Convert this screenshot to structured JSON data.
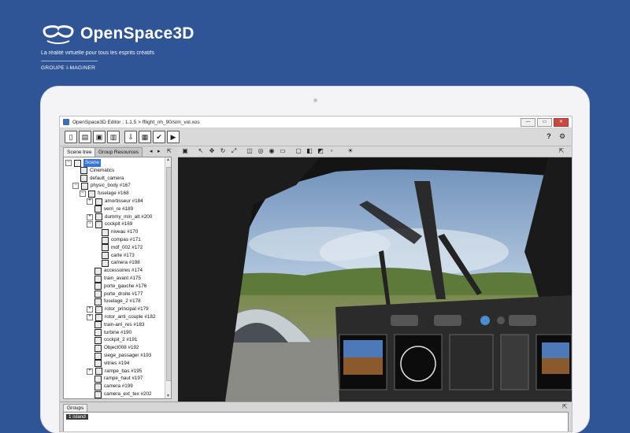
{
  "brand": {
    "title": "OpenSpace3D",
    "tagline": "La réalité virtuelle pour tous les esprits créatifs",
    "company": "GROUPE I-MAGINER"
  },
  "window": {
    "title": "OpenSpace3D Editor : 1.1.5 > fflight_nh_90/sim_vol.xos",
    "buttons": [
      "—",
      "▭",
      "✕"
    ]
  },
  "main_toolbar": {
    "left_icons": [
      "new-project-icon",
      "open-project-icon",
      "save-icon",
      "save-as-icon",
      "import-icon",
      "package-icon",
      "plugit-icon",
      "run-icon"
    ],
    "right_icons": [
      "help-icon",
      "settings-icon"
    ],
    "help_glyph": "?",
    "settings_glyph": "⚙"
  },
  "left_panel": {
    "tabs": [
      "Scene tree",
      "Group Resources"
    ],
    "tree": [
      {
        "label": "Scene",
        "depth": 0,
        "expander": "−",
        "selected": true
      },
      {
        "label": "Cinematics",
        "depth": 1,
        "expander": ""
      },
      {
        "label": "default_camera",
        "depth": 1,
        "expander": ""
      },
      {
        "label": "physic_body #167",
        "depth": 1,
        "expander": "−"
      },
      {
        "label": "fuselage #168",
        "depth": 2,
        "expander": "−"
      },
      {
        "label": "amortisseur #184",
        "depth": 3,
        "expander": "+"
      },
      {
        "label": "verri_re #189",
        "depth": 3,
        "expander": ""
      },
      {
        "label": "dummy_min_alt #200",
        "depth": 3,
        "expander": "+"
      },
      {
        "label": "cockpit #169",
        "depth": 3,
        "expander": "−"
      },
      {
        "label": "niveau #170",
        "depth": 4,
        "expander": ""
      },
      {
        "label": "compas #171",
        "depth": 4,
        "expander": ""
      },
      {
        "label": "mdf_002 #172",
        "depth": 4,
        "expander": ""
      },
      {
        "label": "carte #173",
        "depth": 4,
        "expander": ""
      },
      {
        "label": "camera #198",
        "depth": 4,
        "expander": ""
      },
      {
        "label": "accessoires #174",
        "depth": 3,
        "expander": ""
      },
      {
        "label": "train_avant #175",
        "depth": 3,
        "expander": ""
      },
      {
        "label": "porte_gauche #176",
        "depth": 3,
        "expander": ""
      },
      {
        "label": "porte_droite #177",
        "depth": 3,
        "expander": ""
      },
      {
        "label": "fuselage_2 #178",
        "depth": 3,
        "expander": ""
      },
      {
        "label": "rotor_principal #179",
        "depth": 3,
        "expander": "+"
      },
      {
        "label": "rotor_anti_couple #182",
        "depth": 3,
        "expander": "+"
      },
      {
        "label": "train-arri_res #183",
        "depth": 3,
        "expander": ""
      },
      {
        "label": "turbine #190",
        "depth": 3,
        "expander": ""
      },
      {
        "label": "cockpit_2 #191",
        "depth": 3,
        "expander": ""
      },
      {
        "label": "Object008 #192",
        "depth": 3,
        "expander": ""
      },
      {
        "label": "siege_passager #193",
        "depth": 3,
        "expander": ""
      },
      {
        "label": "vitries #194",
        "depth": 3,
        "expander": ""
      },
      {
        "label": "rampe_bas #195",
        "depth": 3,
        "expander": "+"
      },
      {
        "label": "rampe_haut #197",
        "depth": 3,
        "expander": ""
      },
      {
        "label": "camera #199",
        "depth": 3,
        "expander": ""
      },
      {
        "label": "camera_ext_tex #202",
        "depth": 3,
        "expander": ""
      }
    ]
  },
  "view_toolbar": {
    "icons": [
      "view-mode-icon",
      "pointer-icon",
      "move-icon",
      "rotate-icon",
      "scale-icon",
      "camera-icon",
      "orbit-icon",
      "render-icon",
      "front-view-icon",
      "side-view-icon",
      "top-view-icon",
      "perspective-icon",
      "helpers-icon"
    ]
  },
  "bottom_panel": {
    "tab": "Groups",
    "items": [
      "1 island"
    ]
  }
}
